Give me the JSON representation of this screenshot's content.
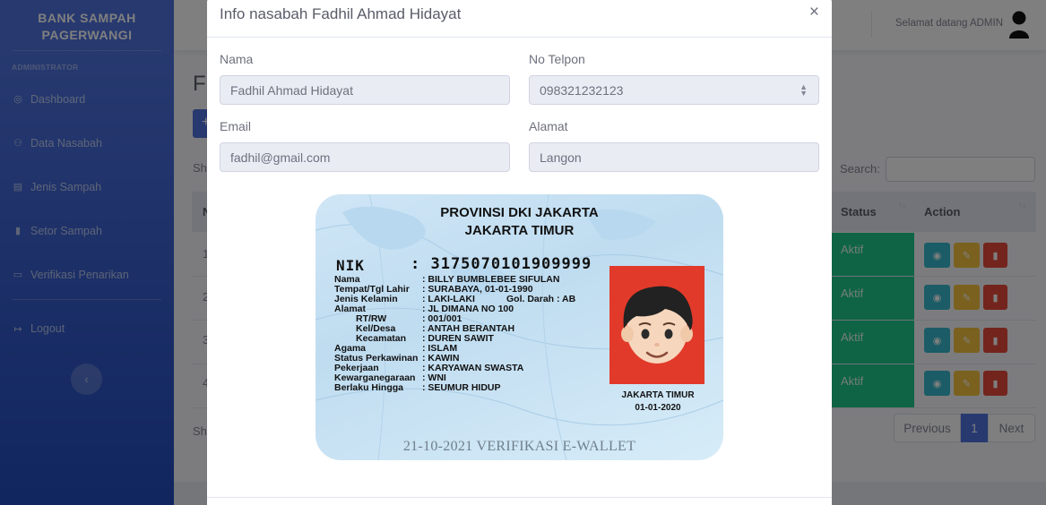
{
  "sidebar": {
    "brand_line1": "BANK SAMPAH",
    "brand_line2": "PAGERWANGI",
    "heading": "ADMINISTRATOR",
    "items": [
      {
        "label": "Dashboard",
        "icon": "tachometer-icon"
      },
      {
        "label": "Data Nasabah",
        "icon": "users-icon"
      },
      {
        "label": "Jenis Sampah",
        "icon": "list-icon"
      },
      {
        "label": "Setor Sampah",
        "icon": "trash-icon"
      },
      {
        "label": "Verifikasi Penarikan",
        "icon": "money-icon"
      },
      {
        "label": "Logout",
        "icon": "sign-out-icon"
      }
    ],
    "toggle_glyph": "‹"
  },
  "topbar": {
    "welcome": "Selamat datang ADMIN"
  },
  "page": {
    "title_fragment": "F",
    "add_glyph": "+",
    "show_fragment": "Sh",
    "search_label": "Search:",
    "table": {
      "first_col_fragment": "N",
      "status_header": "Status",
      "action_header": "Action",
      "rows": [
        {
          "num": "1",
          "status": "Aktif"
        },
        {
          "num": "2",
          "status": "Aktif"
        },
        {
          "num": "3",
          "status": "Aktif"
        },
        {
          "num": "4",
          "status": "Aktif"
        }
      ]
    },
    "pagination": {
      "previous": "Previous",
      "current": "1",
      "next": "Next"
    }
  },
  "modal": {
    "title": "Info nasabah Fadhil Ahmad Hidayat",
    "close": "×",
    "fields": {
      "nama_label": "Nama",
      "nama_value": "Fadhil Ahmad Hidayat",
      "telpon_label": "No Telpon",
      "telpon_value": "098321232123",
      "email_label": "Email",
      "email_value": "fadhil@gmail.com",
      "alamat_label": "Alamat",
      "alamat_value": "Langon"
    },
    "ktp": {
      "province": "PROVINSI DKI JAKARTA",
      "city": "JAKARTA TIMUR",
      "nik_label": "NIK",
      "nik": ": 3175070101909999",
      "rows": [
        {
          "label": "Nama",
          "value": ": BILLY BUMBLEBEE SIFULAN"
        },
        {
          "label": "Tempat/Tgl Lahir",
          "value": ": SURABAYA, 01-01-1990"
        },
        {
          "label": "Jenis Kelamin",
          "value": ": LAKI-LAKI"
        },
        {
          "label": "Alamat",
          "value": ": JL DIMANA NO 100"
        },
        {
          "label": "RT/RW",
          "value": ": 001/001"
        },
        {
          "label": "Kel/Desa",
          "value": ": ANTAH BERANTAH"
        },
        {
          "label": "Kecamatan",
          "value": ": DUREN SAWIT"
        },
        {
          "label": "Agama",
          "value": ": ISLAM"
        },
        {
          "label": "Status Perkawinan",
          "value": ": KAWIN"
        },
        {
          "label": "Pekerjaan",
          "value": ": KARYAWAN SWASTA"
        },
        {
          "label": "Kewarganegaraan",
          "value": ": WNI"
        },
        {
          "label": "Berlaku Hingga",
          "value": ": SEUMUR HIDUP"
        }
      ],
      "blood_type": "Gol. Darah : AB",
      "issue_place": "JAKARTA TIMUR",
      "issue_date": "01-01-2020",
      "stamp": "21-10-2021 VERIFIKASI E-WALLET"
    }
  },
  "colors": {
    "sidebar_primary": "#4e73df",
    "status_active": "#1cc88a",
    "btn_view": "#36b9cc",
    "btn_edit": "#f6c23e",
    "btn_delete": "#e74a3b",
    "photo_background": "#e23a2a"
  }
}
